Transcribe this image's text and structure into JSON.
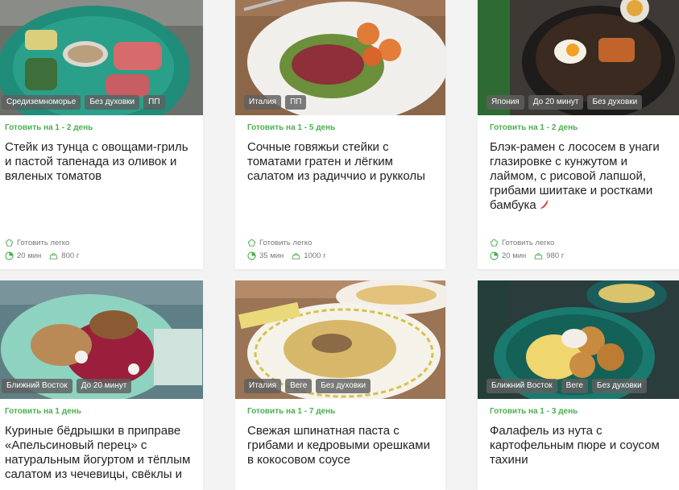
{
  "cards": [
    {
      "tags": [
        "Средиземноморье",
        "Без духовки",
        "ПП"
      ],
      "cook_when": "Готовить на 1 - 2 день",
      "title": "Стейк из тунца с овощами-гриль и пастой тапенада из оливок и вяленых томатов",
      "difficulty": "Готовить легко",
      "time": "20 мин",
      "weight": "800 г"
    },
    {
      "tags": [
        "Италия",
        "ПП"
      ],
      "cook_when": "Готовить на 1 - 5 день",
      "title": "Сочные говяжьи стейки с томатами гратен и лёгким салатом из радиччио и рукколы",
      "difficulty": "Готовить легко",
      "time": "35 мин",
      "weight": "1000 г"
    },
    {
      "tags": [
        "Япония",
        "До 20 минут",
        "Без духовки"
      ],
      "cook_when": "Готовить на 1 - 2 день",
      "title": "Блэк-рамен с лососем в унаги глазировке с кунжутом и лаймом, с рисовой лапшой, грибами шиитаке и ростками бамбука",
      "spicy_icon": "chili-pepper-icon",
      "difficulty": "Готовить легко",
      "time": "20 мин",
      "weight": "980 г"
    },
    {
      "tags": [
        "Ближний Восток",
        "До 20 минут"
      ],
      "cook_when": "Готовить на 1 день",
      "title": "Куриные бёдрышки в приправе «Апельсиновый перец» с натуральным йогуртом и тёплым салатом из чечевицы, свёклы и"
    },
    {
      "tags": [
        "Италия",
        "Веге",
        "Без духовки"
      ],
      "cook_when": "Готовить на 1 - 7 день",
      "title": "Свежая шпинатная паста с грибами и кедровыми орешками в кокосовом соусе"
    },
    {
      "tags": [
        "Ближний Восток",
        "Веге",
        "Без духовки"
      ],
      "cook_when": "Готовить на 1 - 3 день",
      "title": "Фалафель из нута с картофельным пюре и соусом тахини"
    }
  ],
  "colors": {
    "accent_green": "#4caf50",
    "tag_bg": "#5f5f5f"
  }
}
